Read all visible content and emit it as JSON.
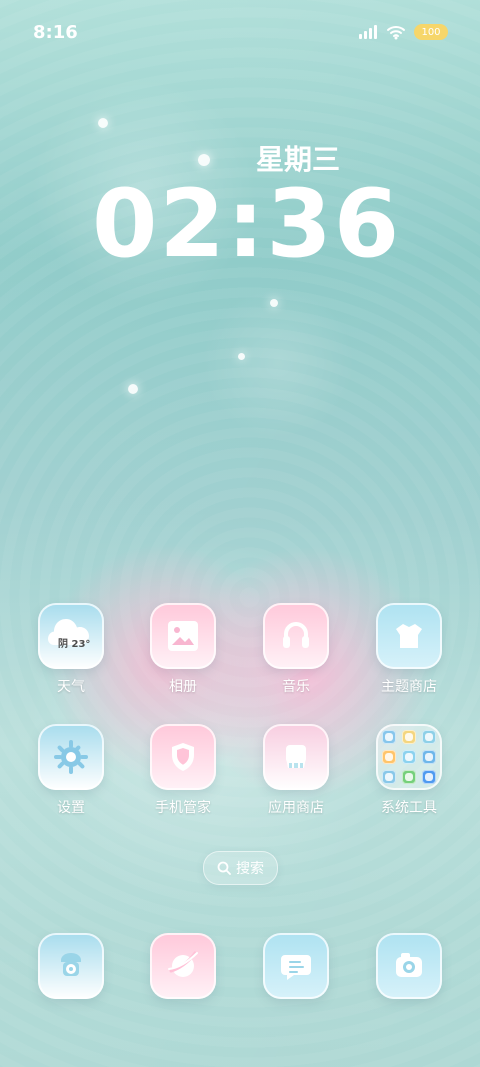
{
  "status_bar": {
    "time": "8:16",
    "battery": "100"
  },
  "lock_display": {
    "weekday": "星期三",
    "clock": "02:36"
  },
  "apps_row_1": [
    {
      "label": "天气",
      "icon": "weather-icon",
      "weather_text": "阴 23°"
    },
    {
      "label": "相册",
      "icon": "photos-icon"
    },
    {
      "label": "音乐",
      "icon": "music-icon"
    },
    {
      "label": "主题商店",
      "icon": "theme-store-icon"
    }
  ],
  "apps_row_2": [
    {
      "label": "设置",
      "icon": "settings-icon"
    },
    {
      "label": "手机管家",
      "icon": "security-icon"
    },
    {
      "label": "应用商店",
      "icon": "app-store-icon"
    },
    {
      "label": "系统工具",
      "icon": "system-tools-folder-icon"
    }
  ],
  "search": {
    "label": "搜索"
  },
  "dock": [
    {
      "icon": "phone-icon"
    },
    {
      "icon": "browser-icon"
    },
    {
      "icon": "messages-icon"
    },
    {
      "icon": "camera-icon"
    }
  ],
  "colors": {
    "accent_blue": "#a7dced",
    "accent_pink": "#f8cde0",
    "battery": "#f6d66a"
  }
}
